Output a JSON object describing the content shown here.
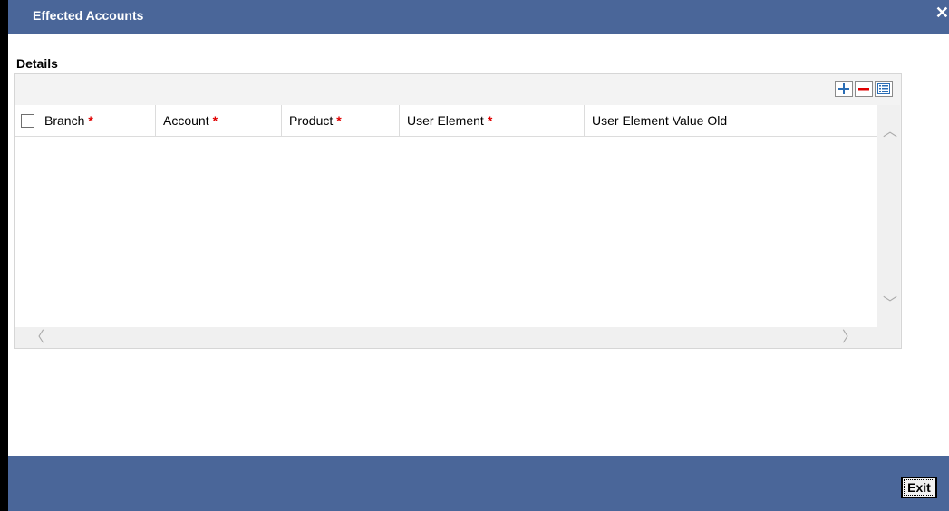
{
  "window": {
    "title": "Effected Accounts",
    "close_glyph": "✕"
  },
  "section": {
    "label": "Details"
  },
  "toolbar": {
    "add_icon": "plus-icon",
    "remove_icon": "minus-icon",
    "view_icon": "list-view-icon"
  },
  "grid": {
    "columns": [
      {
        "label": "Branch",
        "required": "*"
      },
      {
        "label": "Account",
        "required": "*"
      },
      {
        "label": "Product",
        "required": "*"
      },
      {
        "label": "User Element",
        "required": "*"
      },
      {
        "label": "User Element Value Old",
        "required": ""
      }
    ],
    "rows": []
  },
  "scroll": {
    "up": "︿",
    "down": "﹀",
    "left": "〈",
    "right": "〉"
  },
  "footer": {
    "exit_label": "Exit"
  },
  "colors": {
    "bar": "#4a6699",
    "required": "#e00000",
    "toolbar_icon": "#2a6db5",
    "toolbar_minus": "#e00000"
  }
}
